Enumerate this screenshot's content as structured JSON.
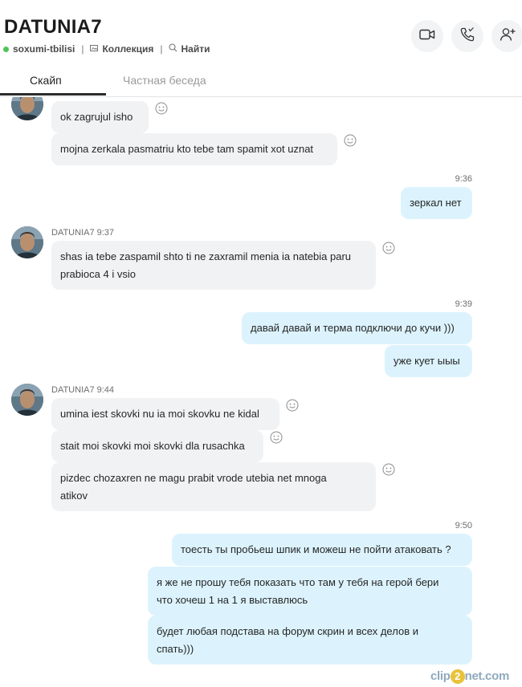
{
  "contact": {
    "name": "DATUNIA7",
    "status": "soxumi-tbilisi",
    "collection_label": "Коллекция",
    "search_label": "Найти",
    "status_color": "#4fc45a"
  },
  "header_actions": [
    {
      "name": "video-call",
      "icon": "video-camera-icon"
    },
    {
      "name": "audio-call",
      "icon": "phone-icon"
    },
    {
      "name": "add-people",
      "icon": "add-person-icon"
    }
  ],
  "tabs": [
    {
      "label": "Скайп",
      "active": true
    },
    {
      "label": "Частная беседа",
      "active": false
    }
  ],
  "messages": {
    "g1_b1": "ok zagrujul isho",
    "g1_b2": "mojna zerkala pasmatriu kto  tebe tam spamit xot uznat",
    "g2_time": "9:36",
    "g2_b1": "зеркал нет",
    "g3_sender": "DATUNIA7 9:37",
    "g3_b1_l1": "shas ia tebe zaspamil  shto ti ne zaxramil menia ia natebia paru",
    "g3_b1_l2": "prabioca 4 i vsio",
    "g4_time": "9:39",
    "g4_b1": "давай давай и терма подключи до кучи )))",
    "g4_b2": "уже кует ыыы",
    "g5_sender": "DATUNIA7 9:44",
    "g5_b1": "umina iest skovki nu ia moi skovku ne kidal",
    "g5_b2": "stait moi skovki moi skovki dla rusachka",
    "g5_b3_l1": "pizdec chozaxren ne magu prabit vrode utebia net mnoga",
    "g5_b3_l2": "atikov",
    "g6_time": "9:50",
    "g6_b1": "тоесть ты пробьеш шпик и можеш не пойти атаковать ?",
    "g6_b2_l1": "я же не прошу тебя показать что там у тебя на герой бери",
    "g6_b2_l2": "что хочеш 1 на 1 я выставлюсь",
    "g6_b3_l1": "будет любая подстава на форум скрин и всех делов и",
    "g6_b3_l2": "спать)))"
  },
  "watermark": {
    "pre": "clip",
    "two": "2",
    "post": "net.com"
  },
  "colors": {
    "incoming": "#f1f2f4",
    "outgoing": "#dcf3fd"
  }
}
